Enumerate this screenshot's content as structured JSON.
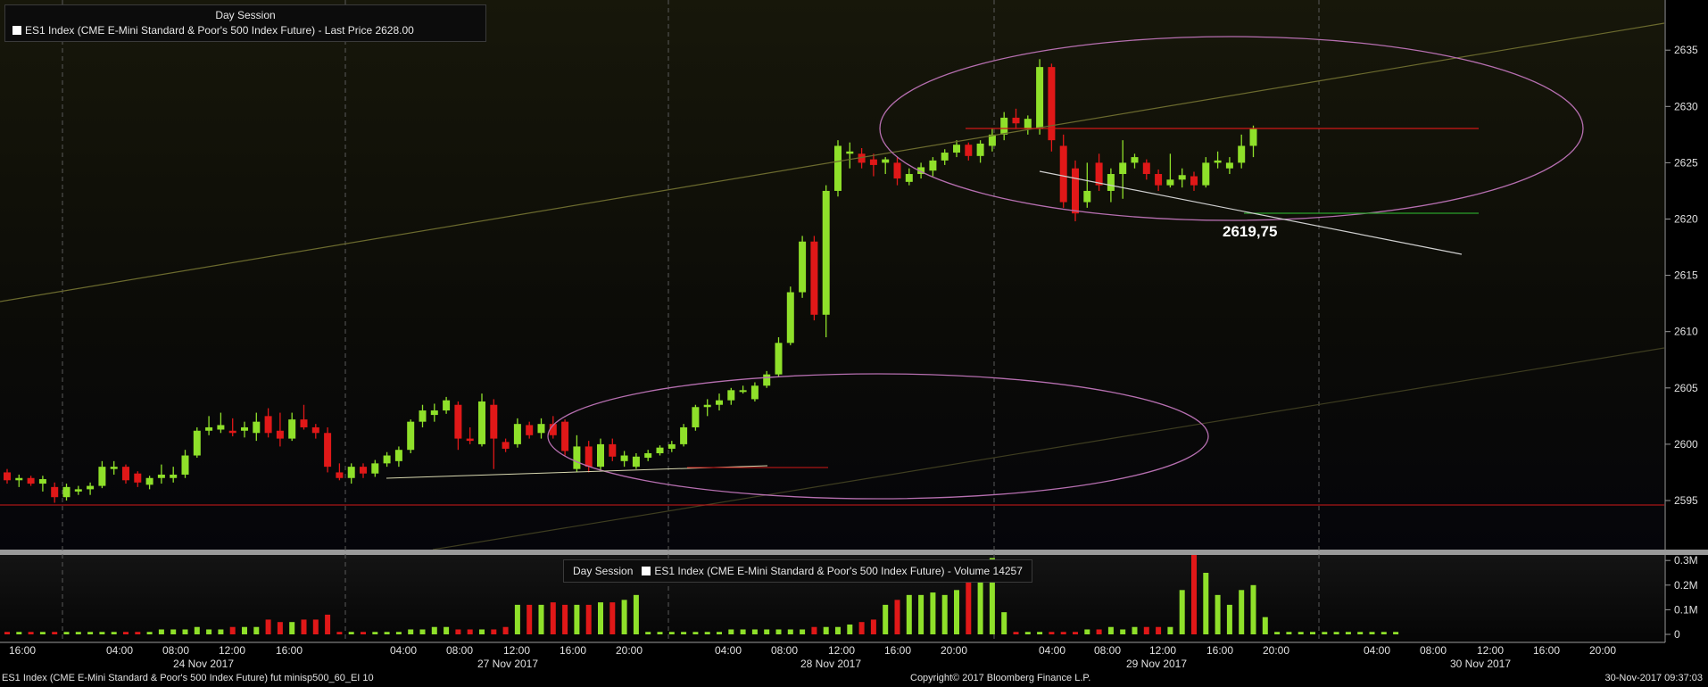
{
  "price_legend": {
    "session": "Day Session",
    "series": "ES1 Index (CME E-Mini Standard & Poor's 500 Index Future) - Last Price 2628.00"
  },
  "volume_legend": {
    "session": "Day Session",
    "series": "ES1 Index (CME E-Mini Standard & Poor's 500 Index Future) - Volume 14257"
  },
  "annotation": "2619,75",
  "footer": {
    "left": "ES1 Index (CME E-Mini Standard & Poor's 500 Index Future) fut minisp500_60_EI 10",
    "center": "Copyright© 2017 Bloomberg Finance L.P.",
    "right": "30-Nov-2017 09:37:03"
  },
  "colors": {
    "up": "#8fe02a",
    "down": "#e01818",
    "trend_channel": "#6b6a2e",
    "ellipse": "#b66fb0",
    "resistance": "#d01818",
    "support": "#2aa02a",
    "trendline": "#cfcfcf"
  },
  "chart_data": [
    {
      "type": "candlestick",
      "title": "Day Session",
      "ylim": [
        2592,
        2636
      ],
      "yticks": [
        2595,
        2600,
        2605,
        2610,
        2615,
        2620,
        2625,
        2630,
        2635
      ],
      "x_time_ticks": [
        "16:00",
        "04:00",
        "08:00",
        "12:00",
        "16:00",
        "04:00",
        "08:00",
        "12:00",
        "16:00",
        "20:00",
        "04:00",
        "08:00",
        "12:00",
        "16:00",
        "20:00",
        "04:00",
        "08:00",
        "12:00",
        "16:00",
        "20:00",
        "04:00",
        "08:00",
        "12:00",
        "16:00",
        "20:00"
      ],
      "x_date_labels": [
        "24 Nov 2017",
        "27 Nov 2017",
        "28 Nov 2017",
        "29 Nov 2017",
        "30 Nov 2017"
      ],
      "candles": [
        {
          "o": 2597.5,
          "h": 2597.8,
          "l": 2596.5,
          "c": 2596.8
        },
        {
          "o": 2596.8,
          "h": 2597.3,
          "l": 2596.2,
          "c": 2597.0
        },
        {
          "o": 2597.0,
          "h": 2597.2,
          "l": 2596.3,
          "c": 2596.5
        },
        {
          "o": 2596.5,
          "h": 2597.2,
          "l": 2595.8,
          "c": 2596.9
        },
        {
          "o": 2596.2,
          "h": 2596.6,
          "l": 2594.8,
          "c": 2595.3
        },
        {
          "o": 2595.3,
          "h": 2596.5,
          "l": 2595.0,
          "c": 2596.2
        },
        {
          "o": 2595.8,
          "h": 2596.3,
          "l": 2595.5,
          "c": 2596.0
        },
        {
          "o": 2596.0,
          "h": 2596.6,
          "l": 2595.5,
          "c": 2596.3
        },
        {
          "o": 2596.3,
          "h": 2598.5,
          "l": 2596.1,
          "c": 2598.0
        },
        {
          "o": 2597.8,
          "h": 2598.5,
          "l": 2597.3,
          "c": 2598.0
        },
        {
          "o": 2598.0,
          "h": 2598.2,
          "l": 2596.5,
          "c": 2596.8
        },
        {
          "o": 2597.4,
          "h": 2597.6,
          "l": 2596.2,
          "c": 2596.6
        },
        {
          "o": 2596.4,
          "h": 2597.2,
          "l": 2596.0,
          "c": 2597.0
        },
        {
          "o": 2597.0,
          "h": 2598.2,
          "l": 2596.5,
          "c": 2597.3
        },
        {
          "o": 2597.0,
          "h": 2598.0,
          "l": 2596.6,
          "c": 2597.3
        },
        {
          "o": 2597.3,
          "h": 2599.5,
          "l": 2597.0,
          "c": 2599.0
        },
        {
          "o": 2599.0,
          "h": 2601.5,
          "l": 2598.8,
          "c": 2601.2
        },
        {
          "o": 2601.2,
          "h": 2602.5,
          "l": 2600.8,
          "c": 2601.5
        },
        {
          "o": 2601.3,
          "h": 2602.8,
          "l": 2601.0,
          "c": 2601.7
        },
        {
          "o": 2601.2,
          "h": 2602.3,
          "l": 2600.7,
          "c": 2601.0
        },
        {
          "o": 2601.2,
          "h": 2602.0,
          "l": 2600.6,
          "c": 2601.5
        },
        {
          "o": 2601.0,
          "h": 2602.8,
          "l": 2600.3,
          "c": 2602.0
        },
        {
          "o": 2602.5,
          "h": 2603.2,
          "l": 2600.6,
          "c": 2601.0
        },
        {
          "o": 2601.2,
          "h": 2602.8,
          "l": 2599.8,
          "c": 2600.5
        },
        {
          "o": 2600.5,
          "h": 2602.8,
          "l": 2600.3,
          "c": 2602.2
        },
        {
          "o": 2602.2,
          "h": 2603.5,
          "l": 2601.3,
          "c": 2601.5
        },
        {
          "o": 2601.5,
          "h": 2601.8,
          "l": 2600.5,
          "c": 2601.0
        },
        {
          "o": 2601.0,
          "h": 2601.5,
          "l": 2597.5,
          "c": 2598.0
        },
        {
          "o": 2597.5,
          "h": 2598.3,
          "l": 2596.8,
          "c": 2597.0
        },
        {
          "o": 2597.0,
          "h": 2598.3,
          "l": 2596.5,
          "c": 2598.0
        },
        {
          "o": 2598.0,
          "h": 2598.3,
          "l": 2597.0,
          "c": 2597.4
        },
        {
          "o": 2597.4,
          "h": 2598.6,
          "l": 2597.1,
          "c": 2598.3
        },
        {
          "o": 2598.3,
          "h": 2599.3,
          "l": 2598.0,
          "c": 2599.0
        },
        {
          "o": 2598.5,
          "h": 2599.8,
          "l": 2598.0,
          "c": 2599.5
        },
        {
          "o": 2599.5,
          "h": 2602.2,
          "l": 2599.2,
          "c": 2602.0
        },
        {
          "o": 2602.0,
          "h": 2603.5,
          "l": 2601.5,
          "c": 2603.0
        },
        {
          "o": 2602.6,
          "h": 2603.6,
          "l": 2602.0,
          "c": 2603.0
        },
        {
          "o": 2603.0,
          "h": 2604.2,
          "l": 2602.7,
          "c": 2603.9
        },
        {
          "o": 2603.5,
          "h": 2603.8,
          "l": 2599.5,
          "c": 2600.5
        },
        {
          "o": 2600.5,
          "h": 2601.5,
          "l": 2600.0,
          "c": 2600.3
        },
        {
          "o": 2600.0,
          "h": 2604.5,
          "l": 2599.8,
          "c": 2603.8
        },
        {
          "o": 2603.5,
          "h": 2604.0,
          "l": 2597.8,
          "c": 2600.5
        },
        {
          "o": 2600.2,
          "h": 2600.5,
          "l": 2599.3,
          "c": 2599.6
        },
        {
          "o": 2600.0,
          "h": 2602.3,
          "l": 2599.7,
          "c": 2601.8
        },
        {
          "o": 2601.7,
          "h": 2602.0,
          "l": 2600.5,
          "c": 2600.8
        },
        {
          "o": 2601.0,
          "h": 2602.3,
          "l": 2600.5,
          "c": 2601.8
        },
        {
          "o": 2601.8,
          "h": 2602.5,
          "l": 2600.5,
          "c": 2600.8
        },
        {
          "o": 2602.0,
          "h": 2602.2,
          "l": 2599.0,
          "c": 2599.4
        },
        {
          "o": 2597.8,
          "h": 2600.8,
          "l": 2597.5,
          "c": 2599.8
        },
        {
          "o": 2599.8,
          "h": 2600.3,
          "l": 2597.5,
          "c": 2598.0
        },
        {
          "o": 2598.0,
          "h": 2600.5,
          "l": 2597.7,
          "c": 2600.0
        },
        {
          "o": 2600.0,
          "h": 2600.5,
          "l": 2598.5,
          "c": 2598.9
        },
        {
          "o": 2598.5,
          "h": 2599.4,
          "l": 2598.0,
          "c": 2599.0
        },
        {
          "o": 2598.0,
          "h": 2599.2,
          "l": 2597.8,
          "c": 2598.9
        },
        {
          "o": 2598.8,
          "h": 2599.5,
          "l": 2598.5,
          "c": 2599.2
        },
        {
          "o": 2599.2,
          "h": 2599.9,
          "l": 2599.0,
          "c": 2599.7
        },
        {
          "o": 2599.6,
          "h": 2600.3,
          "l": 2599.3,
          "c": 2600.0
        },
        {
          "o": 2600.0,
          "h": 2601.8,
          "l": 2599.8,
          "c": 2601.5
        },
        {
          "o": 2601.5,
          "h": 2603.5,
          "l": 2601.2,
          "c": 2603.3
        },
        {
          "o": 2603.3,
          "h": 2604.0,
          "l": 2602.5,
          "c": 2603.5
        },
        {
          "o": 2603.5,
          "h": 2604.5,
          "l": 2603.0,
          "c": 2603.9
        },
        {
          "o": 2603.9,
          "h": 2605.0,
          "l": 2603.5,
          "c": 2604.8
        },
        {
          "o": 2604.8,
          "h": 2605.2,
          "l": 2604.5,
          "c": 2604.8
        },
        {
          "o": 2604.0,
          "h": 2605.5,
          "l": 2603.8,
          "c": 2605.2
        },
        {
          "o": 2605.2,
          "h": 2606.5,
          "l": 2605.0,
          "c": 2606.2
        },
        {
          "o": 2606.2,
          "h": 2609.5,
          "l": 2606.0,
          "c": 2609.0
        },
        {
          "o": 2609.0,
          "h": 2614.0,
          "l": 2608.8,
          "c": 2613.5
        },
        {
          "o": 2613.5,
          "h": 2618.5,
          "l": 2613.0,
          "c": 2618.0
        },
        {
          "o": 2618.0,
          "h": 2618.5,
          "l": 2611.0,
          "c": 2611.5
        },
        {
          "o": 2611.5,
          "h": 2623.0,
          "l": 2609.5,
          "c": 2622.5
        },
        {
          "o": 2622.5,
          "h": 2627.0,
          "l": 2622.0,
          "c": 2626.5
        },
        {
          "o": 2625.8,
          "h": 2626.8,
          "l": 2624.5,
          "c": 2626.0
        },
        {
          "o": 2625.8,
          "h": 2626.3,
          "l": 2624.5,
          "c": 2625.0
        },
        {
          "o": 2625.3,
          "h": 2625.8,
          "l": 2623.8,
          "c": 2624.8
        },
        {
          "o": 2625.0,
          "h": 2625.5,
          "l": 2624.0,
          "c": 2625.3
        },
        {
          "o": 2625.0,
          "h": 2625.5,
          "l": 2623.0,
          "c": 2623.6
        },
        {
          "o": 2623.3,
          "h": 2624.5,
          "l": 2623.0,
          "c": 2624.0
        },
        {
          "o": 2624.0,
          "h": 2625.0,
          "l": 2623.6,
          "c": 2624.6
        },
        {
          "o": 2624.3,
          "h": 2625.5,
          "l": 2623.8,
          "c": 2625.2
        },
        {
          "o": 2625.2,
          "h": 2626.2,
          "l": 2624.8,
          "c": 2625.9
        },
        {
          "o": 2625.9,
          "h": 2627.0,
          "l": 2625.5,
          "c": 2626.6
        },
        {
          "o": 2626.6,
          "h": 2626.8,
          "l": 2625.2,
          "c": 2625.6
        },
        {
          "o": 2625.6,
          "h": 2627.0,
          "l": 2625.0,
          "c": 2626.7
        },
        {
          "o": 2626.5,
          "h": 2628.0,
          "l": 2626.0,
          "c": 2627.5
        },
        {
          "o": 2627.5,
          "h": 2629.5,
          "l": 2627.0,
          "c": 2629.0
        },
        {
          "o": 2629.0,
          "h": 2629.8,
          "l": 2628.0,
          "c": 2628.5
        },
        {
          "o": 2628.0,
          "h": 2629.2,
          "l": 2627.5,
          "c": 2628.9
        },
        {
          "o": 2628.0,
          "h": 2634.2,
          "l": 2627.5,
          "c": 2633.5
        },
        {
          "o": 2633.5,
          "h": 2633.8,
          "l": 2626.0,
          "c": 2627.0
        },
        {
          "o": 2626.5,
          "h": 2627.5,
          "l": 2621.0,
          "c": 2621.5
        },
        {
          "o": 2624.5,
          "h": 2625.2,
          "l": 2619.8,
          "c": 2620.5
        },
        {
          "o": 2621.5,
          "h": 2625.0,
          "l": 2621.0,
          "c": 2622.5
        },
        {
          "o": 2625.0,
          "h": 2625.8,
          "l": 2622.5,
          "c": 2623.0
        },
        {
          "o": 2622.5,
          "h": 2624.5,
          "l": 2621.5,
          "c": 2624.0
        },
        {
          "o": 2624.0,
          "h": 2627.0,
          "l": 2621.8,
          "c": 2625.0
        },
        {
          "o": 2625.0,
          "h": 2625.8,
          "l": 2624.5,
          "c": 2625.5
        },
        {
          "o": 2625.0,
          "h": 2625.3,
          "l": 2623.5,
          "c": 2624.0
        },
        {
          "o": 2624.0,
          "h": 2624.4,
          "l": 2622.5,
          "c": 2623.0
        },
        {
          "o": 2623.0,
          "h": 2625.8,
          "l": 2622.8,
          "c": 2623.5
        },
        {
          "o": 2623.5,
          "h": 2624.5,
          "l": 2622.8,
          "c": 2623.9
        },
        {
          "o": 2623.8,
          "h": 2624.2,
          "l": 2622.5,
          "c": 2623.0
        },
        {
          "o": 2623.0,
          "h": 2625.5,
          "l": 2622.8,
          "c": 2625.0
        },
        {
          "o": 2625.0,
          "h": 2626.0,
          "l": 2624.5,
          "c": 2625.2
        },
        {
          "o": 2624.5,
          "h": 2625.5,
          "l": 2624.0,
          "c": 2625.0
        },
        {
          "o": 2625.0,
          "h": 2627.5,
          "l": 2624.5,
          "c": 2626.5
        },
        {
          "o": 2626.5,
          "h": 2628.3,
          "l": 2625.5,
          "c": 2628.0
        }
      ]
    },
    {
      "type": "bar",
      "title": "Day Session",
      "ylim": [
        0,
        0.37
      ],
      "yticks": [
        0,
        0.1,
        0.2,
        0.3
      ],
      "ytick_labels": [
        "0",
        "0.1M",
        "0.2M",
        "0.3M"
      ],
      "ylabel": "",
      "values_millions": [
        0.01,
        0.01,
        0.01,
        0.01,
        0.01,
        0.01,
        0.01,
        0.01,
        0.01,
        0.01,
        0.01,
        0.01,
        0.01,
        0.02,
        0.02,
        0.02,
        0.03,
        0.02,
        0.02,
        0.03,
        0.03,
        0.03,
        0.06,
        0.05,
        0.05,
        0.06,
        0.06,
        0.08,
        0.01,
        0.01,
        0.01,
        0.01,
        0.01,
        0.01,
        0.02,
        0.02,
        0.03,
        0.03,
        0.02,
        0.02,
        0.02,
        0.02,
        0.03,
        0.12,
        0.12,
        0.12,
        0.13,
        0.12,
        0.12,
        0.12,
        0.13,
        0.13,
        0.14,
        0.16,
        0.01,
        0.01,
        0.01,
        0.01,
        0.01,
        0.01,
        0.01,
        0.02,
        0.02,
        0.02,
        0.02,
        0.02,
        0.02,
        0.02,
        0.03,
        0.03,
        0.03,
        0.04,
        0.05,
        0.06,
        0.12,
        0.14,
        0.16,
        0.16,
        0.17,
        0.16,
        0.18,
        0.22,
        0.3,
        0.31,
        0.09,
        0.01,
        0.01,
        0.01,
        0.01,
        0.01,
        0.01,
        0.02,
        0.02,
        0.03,
        0.02,
        0.03,
        0.03,
        0.03,
        0.03,
        0.18,
        0.36,
        0.25,
        0.16,
        0.12,
        0.18,
        0.2,
        0.07,
        0.01,
        0.01,
        0.01,
        0.01,
        0.01,
        0.01,
        0.01,
        0.01,
        0.01,
        0.01,
        0.01
      ]
    }
  ]
}
